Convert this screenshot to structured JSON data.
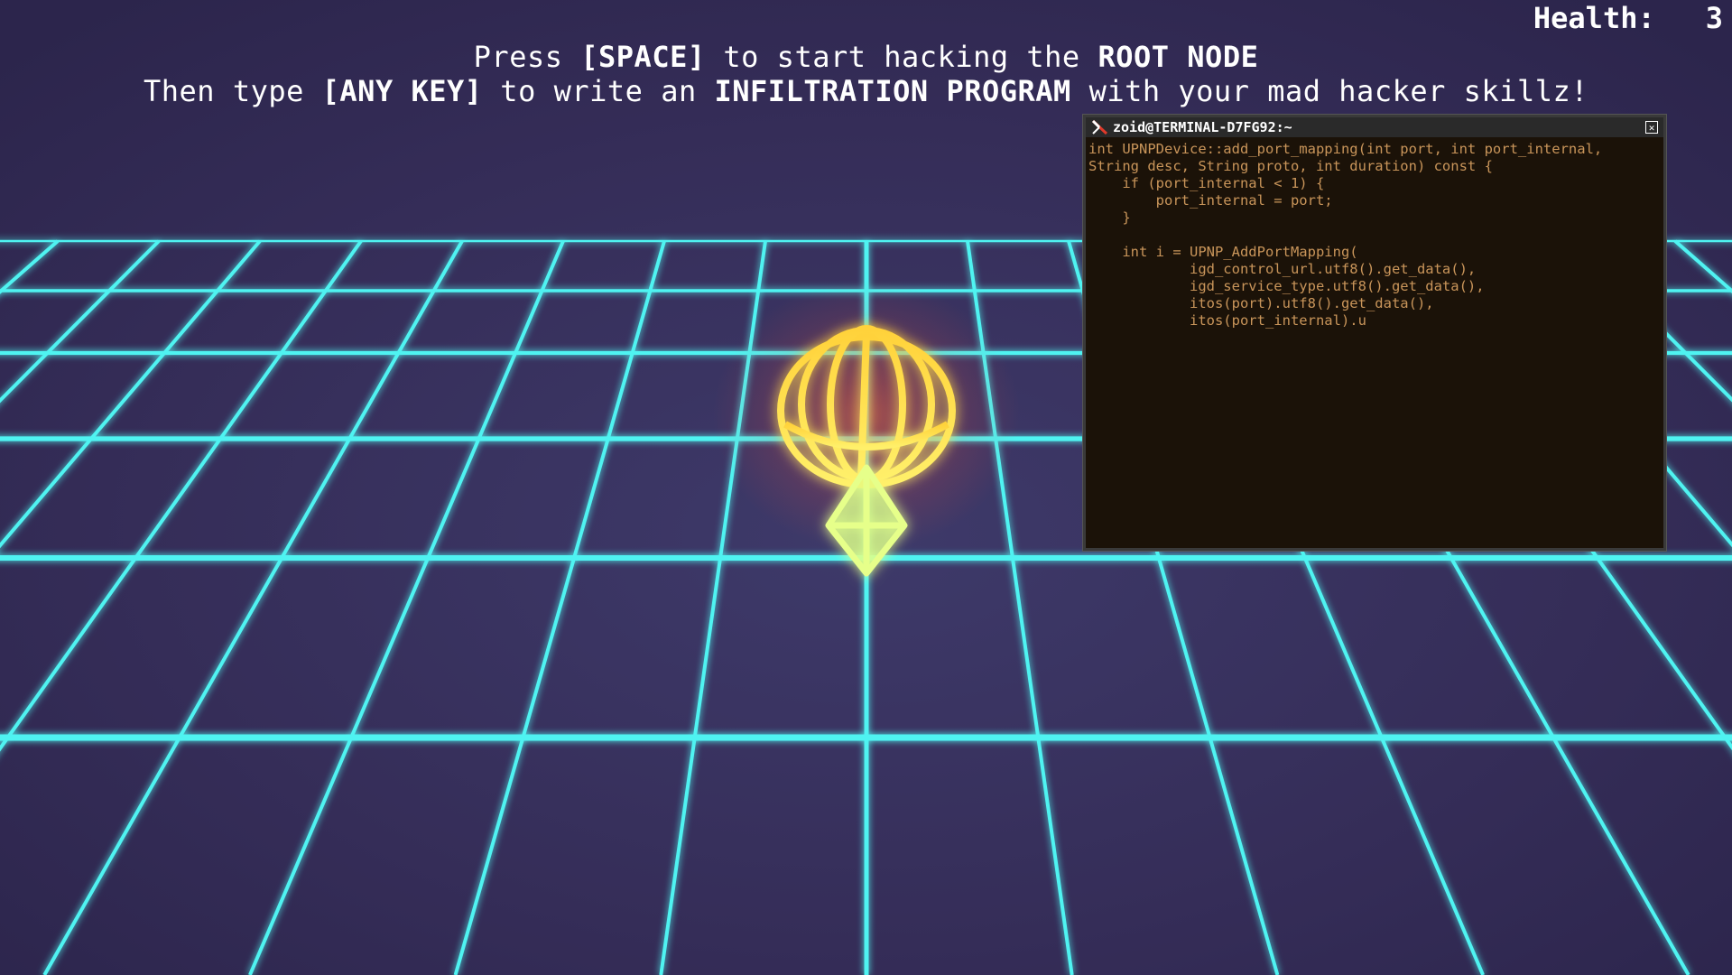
{
  "hud": {
    "health_label": "Health:",
    "health_value": "3"
  },
  "instructions": {
    "line1": [
      {
        "text": "Press ",
        "bold": false
      },
      {
        "text": "[SPACE]",
        "bold": true
      },
      {
        "text": " to start hacking the ",
        "bold": false
      },
      {
        "text": "ROOT NODE",
        "bold": true
      }
    ],
    "line2": [
      {
        "text": "Then type ",
        "bold": false
      },
      {
        "text": "[ANY KEY]",
        "bold": true
      },
      {
        "text": " to write an ",
        "bold": false
      },
      {
        "text": "INFILTRATION PROGRAM",
        "bold": true
      },
      {
        "text": " with your mad hacker skillz!",
        "bold": false
      }
    ]
  },
  "terminal": {
    "title": "zoid@TERMINAL-D7FG92:~",
    "icon": "terminal-icon",
    "close_icon": "close-icon",
    "code": [
      "int UPNPDevice::add_port_mapping(int port, int port_internal,",
      "String desc, String proto, int duration) const {",
      "    if (port_internal < 1) {",
      "        port_internal = port;",
      "    }",
      "",
      "    int i = UPNP_AddPortMapping(",
      "            igd_control_url.utf8().get_data(),",
      "            igd_service_type.utf8().get_data(),",
      "            itos(port).utf8().get_data(),",
      "            itos(port_internal).u"
    ]
  },
  "colors": {
    "background": "#352d58",
    "grid": "#4ff3f1",
    "node_top": "#ffe23a",
    "node_glow": "#ff5a3a",
    "node_bottom": "#e6ff8a",
    "terminal_bg": "#1b1208",
    "terminal_text": "#c9955a"
  }
}
